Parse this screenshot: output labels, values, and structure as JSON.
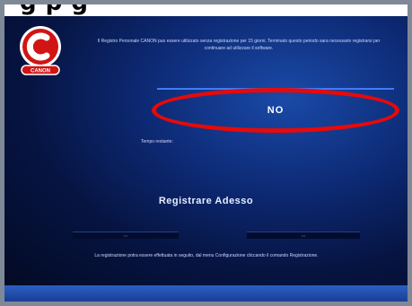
{
  "caption": "g     p g",
  "logo": {
    "label": "CANON"
  },
  "info": {
    "text": "Il Registro Personale CANON puo essere utilizzato senza registrazione per 15 giorni. Terminato questo periodo sara necessario registrarsi per continuare ad utilizzare il software."
  },
  "choice": {
    "label": "NO"
  },
  "remaining": {
    "label": "Tempo restante:"
  },
  "register": {
    "title": "Registrare Adesso"
  },
  "buttons": {
    "left": "<<",
    "right": ">>"
  },
  "footer": {
    "text": "La registrazione potra essere effettuata in seguito, dal menu Configurazione cliccando il comando Registrazione."
  },
  "colors": {
    "highlight": "#e60a0a",
    "window_bg": "#0d2a75",
    "logo_red": "#d11414"
  }
}
